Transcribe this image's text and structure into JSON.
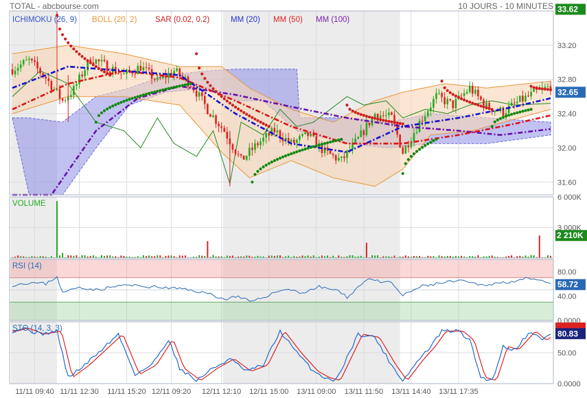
{
  "header": {
    "source": "TOTAL - abcbourse.com",
    "period": "10 JOURS - 10 MINUTES"
  },
  "legend": [
    {
      "text": "ICHIMOKU (26, 9)",
      "color": "#3355cc"
    },
    {
      "text": "BOLL (20, 2)",
      "color": "#e8963c"
    },
    {
      "text": "SAR (0.02, 0.2)",
      "color": "#cc2020"
    },
    {
      "text": "MM (20)",
      "color": "#2233cc"
    },
    {
      "text": "MM (50)",
      "color": "#dd2222"
    },
    {
      "text": "MM (100)",
      "color": "#7722aa"
    }
  ],
  "colors": {
    "bull": "#22aa22",
    "bear": "#dd2222",
    "sar": "#cc2020",
    "sar_bull": "#118811",
    "boll_fill": "#f6d6b4",
    "boll_line": "#e8963c",
    "kumo_fill": "#8f8fe8",
    "chikou": "#228822",
    "mm20": "#1111cc",
    "mm50": "#dd1111",
    "mm100": "#6611aa",
    "rsi_line": "#2a6ab5",
    "sto_k": "#2266cc",
    "sto_d": "#dd2222",
    "badge_green": "#1d8a1d",
    "badge_blue": "#2a6ab5",
    "badge_navy": "#1a237e"
  },
  "chart_data": [
    {
      "type": "candlestick",
      "name": "price",
      "yticks": [
        31.6,
        32.0,
        32.4,
        32.8,
        33.2
      ],
      "ytick_labels": [
        "31.60",
        "32.00",
        "32.40",
        "32.80",
        "33.20"
      ],
      "ylim": [
        31.45,
        33.6
      ],
      "badges": [
        {
          "text": "33.62",
          "value": 33.62,
          "color": "#1d8a1d"
        },
        {
          "text": "32.65",
          "value": 32.65,
          "color": "#2a6ab5"
        }
      ],
      "close_anchors": [
        [
          0,
          32.92
        ],
        [
          6,
          33.02
        ],
        [
          12,
          32.82
        ],
        [
          18,
          32.55
        ],
        [
          22,
          32.68
        ],
        [
          28,
          33.05
        ],
        [
          34,
          32.95
        ],
        [
          40,
          32.85
        ],
        [
          46,
          32.95
        ],
        [
          52,
          32.78
        ],
        [
          58,
          32.9
        ],
        [
          64,
          32.75
        ],
        [
          70,
          32.45
        ],
        [
          76,
          32.2
        ],
        [
          82,
          31.85
        ],
        [
          88,
          32.05
        ],
        [
          94,
          32.2
        ],
        [
          100,
          32.05
        ],
        [
          106,
          32.15
        ],
        [
          112,
          31.95
        ],
        [
          118,
          31.85
        ],
        [
          124,
          32.1
        ],
        [
          130,
          32.4
        ],
        [
          136,
          32.35
        ],
        [
          140,
          31.95
        ],
        [
          146,
          32.3
        ],
        [
          152,
          32.6
        ],
        [
          158,
          32.5
        ],
        [
          164,
          32.7
        ],
        [
          170,
          32.48
        ],
        [
          176,
          32.42
        ],
        [
          182,
          32.55
        ],
        [
          188,
          32.65
        ],
        [
          193,
          32.72
        ]
      ],
      "mm20_anchors": [
        [
          0,
          32.7
        ],
        [
          20,
          32.95
        ],
        [
          40,
          32.9
        ],
        [
          60,
          32.85
        ],
        [
          80,
          32.4
        ],
        [
          100,
          32.05
        ],
        [
          120,
          31.95
        ],
        [
          140,
          32.25
        ],
        [
          160,
          32.35
        ],
        [
          180,
          32.48
        ],
        [
          193,
          32.58
        ]
      ],
      "mm50_anchors": [
        [
          0,
          32.45
        ],
        [
          20,
          32.75
        ],
        [
          40,
          32.9
        ],
        [
          60,
          32.82
        ],
        [
          80,
          32.55
        ],
        [
          100,
          32.25
        ],
        [
          120,
          32.05
        ],
        [
          140,
          32.05
        ],
        [
          160,
          32.15
        ],
        [
          180,
          32.28
        ],
        [
          193,
          32.38
        ]
      ],
      "mm100_anchors": [
        [
          14,
          31.45
        ],
        [
          30,
          32.2
        ],
        [
          45,
          32.58
        ],
        [
          60,
          32.72
        ],
        [
          80,
          32.62
        ],
        [
          100,
          32.48
        ],
        [
          120,
          32.35
        ],
        [
          140,
          32.25
        ],
        [
          160,
          32.2
        ],
        [
          175,
          32.15
        ],
        [
          193,
          32.22
        ]
      ],
      "boll_upper": [
        [
          0,
          33.1
        ],
        [
          20,
          33.2
        ],
        [
          40,
          33.1
        ],
        [
          60,
          32.95
        ],
        [
          75,
          32.95
        ],
        [
          85,
          32.7
        ],
        [
          100,
          32.45
        ],
        [
          115,
          32.3
        ],
        [
          130,
          32.55
        ],
        [
          140,
          32.65
        ],
        [
          155,
          32.75
        ],
        [
          170,
          32.7
        ],
        [
          193,
          32.78
        ]
      ],
      "boll_lower": [
        [
          0,
          32.4
        ],
        [
          20,
          32.6
        ],
        [
          40,
          32.6
        ],
        [
          60,
          32.5
        ],
        [
          75,
          31.95
        ],
        [
          85,
          31.65
        ],
        [
          100,
          31.85
        ],
        [
          115,
          31.65
        ],
        [
          130,
          31.55
        ],
        [
          140,
          31.75
        ],
        [
          150,
          32.15
        ],
        [
          165,
          32.2
        ],
        [
          193,
          32.45
        ]
      ],
      "kumo_upper": [
        [
          0,
          32.35
        ],
        [
          6,
          32.35
        ],
        [
          18,
          32.3
        ],
        [
          30,
          32.6
        ],
        [
          42,
          32.7
        ],
        [
          55,
          32.85
        ],
        [
          70,
          32.9
        ],
        [
          80,
          32.92
        ],
        [
          90,
          32.92
        ],
        [
          102,
          32.92
        ],
        [
          102,
          32.35
        ],
        [
          120,
          32.35
        ],
        [
          135,
          32.3
        ],
        [
          150,
          32.4
        ],
        [
          170,
          32.35
        ],
        [
          193,
          32.3
        ]
      ],
      "kumo_lower": [
        [
          0,
          32.35
        ],
        [
          6,
          31.45
        ],
        [
          18,
          31.45
        ],
        [
          30,
          32.0
        ],
        [
          42,
          32.5
        ],
        [
          55,
          32.65
        ],
        [
          70,
          32.7
        ],
        [
          80,
          32.55
        ],
        [
          90,
          32.55
        ],
        [
          102,
          32.2
        ],
        [
          120,
          32.05
        ],
        [
          135,
          32.0
        ],
        [
          150,
          32.05
        ],
        [
          170,
          32.05
        ],
        [
          193,
          32.15
        ]
      ],
      "chikou_anchors": [
        [
          0,
          32.6
        ],
        [
          10,
          32.9
        ],
        [
          20,
          32.75
        ],
        [
          30,
          32.3
        ],
        [
          40,
          32.2
        ],
        [
          46,
          32.0
        ],
        [
          52,
          32.35
        ],
        [
          58,
          32.05
        ],
        [
          66,
          31.9
        ],
        [
          72,
          32.2
        ],
        [
          78,
          31.58
        ],
        [
          82,
          32.3
        ],
        [
          90,
          32.15
        ],
        [
          96,
          32.45
        ],
        [
          102,
          32.25
        ],
        [
          108,
          32.3
        ],
        [
          114,
          32.45
        ],
        [
          120,
          32.6
        ],
        [
          126,
          32.5
        ],
        [
          134,
          32.55
        ],
        [
          140,
          32.35
        ],
        [
          148,
          32.45
        ],
        [
          156,
          32.4
        ],
        [
          164,
          32.5
        ],
        [
          172,
          32.55
        ],
        [
          180,
          32.5
        ],
        [
          193,
          32.52
        ]
      ],
      "sar_segments": [
        {
          "bull": false,
          "from": 16,
          "to": 35,
          "start": 33.55,
          "end": 32.85
        },
        {
          "bull": true,
          "from": 30,
          "to": 64,
          "start": 32.3,
          "end": 32.75
        },
        {
          "bull": false,
          "from": 66,
          "to": 92,
          "start": 33.1,
          "end": 32.25
        },
        {
          "bull": true,
          "from": 86,
          "to": 118,
          "start": 31.6,
          "end": 32.1
        },
        {
          "bull": false,
          "from": 120,
          "to": 140,
          "start": 32.5,
          "end": 32.28
        },
        {
          "bull": true,
          "from": 140,
          "to": 152,
          "start": 31.7,
          "end": 32.1
        },
        {
          "bull": false,
          "from": 154,
          "to": 172,
          "start": 32.78,
          "end": 32.45
        },
        {
          "bull": true,
          "from": 172,
          "to": 186,
          "start": 32.25,
          "end": 32.45
        },
        {
          "bull": false,
          "from": 186,
          "to": 193,
          "start": 32.72,
          "end": 32.68
        }
      ]
    },
    {
      "type": "bar",
      "name": "volume",
      "title": "VOLUME",
      "ylim": [
        0,
        6000
      ],
      "yticks": [
        6000,
        3000
      ],
      "ytick_labels": [
        "6 000K",
        "3 000K"
      ],
      "badge": {
        "text": "2 210K",
        "value": 2210,
        "color": "#1d8a1d"
      },
      "spikes": [
        [
          16,
          5600,
          true
        ],
        [
          18,
          500,
          true
        ],
        [
          40,
          200,
          false
        ],
        [
          70,
          1650,
          false
        ],
        [
          72,
          300,
          true
        ],
        [
          127,
          1500,
          false
        ],
        [
          130,
          250,
          true
        ],
        [
          186,
          300,
          true
        ],
        [
          189,
          2210,
          false
        ]
      ]
    },
    {
      "type": "line",
      "name": "rsi",
      "title": "RSI (14)",
      "ylim": [
        0,
        100
      ],
      "yticks": [
        80,
        40,
        0
      ],
      "ytick_labels": [
        "80.00",
        "40.00",
        "0.0000"
      ],
      "overbought": 70,
      "oversold": 30,
      "badge": {
        "text": "58.72",
        "value": 58.72,
        "color": "#2a6ab5"
      },
      "anchors": [
        [
          0,
          58
        ],
        [
          6,
          62
        ],
        [
          12,
          60
        ],
        [
          16,
          72
        ],
        [
          18,
          45
        ],
        [
          24,
          55
        ],
        [
          30,
          50
        ],
        [
          40,
          58
        ],
        [
          50,
          55
        ],
        [
          60,
          52
        ],
        [
          66,
          48
        ],
        [
          72,
          42
        ],
        [
          76,
          34
        ],
        [
          80,
          40
        ],
        [
          86,
          30
        ],
        [
          92,
          42
        ],
        [
          98,
          52
        ],
        [
          104,
          45
        ],
        [
          110,
          55
        ],
        [
          116,
          50
        ],
        [
          120,
          38
        ],
        [
          124,
          55
        ],
        [
          128,
          70
        ],
        [
          132,
          62
        ],
        [
          136,
          62
        ],
        [
          140,
          40
        ],
        [
          146,
          55
        ],
        [
          152,
          60
        ],
        [
          160,
          65
        ],
        [
          168,
          58
        ],
        [
          176,
          62
        ],
        [
          184,
          68
        ],
        [
          190,
          64
        ],
        [
          193,
          58.72
        ]
      ]
    },
    {
      "type": "line",
      "name": "stochastic",
      "title": "STO (14, 3, 3)",
      "ylim": [
        0,
        100
      ],
      "yticks": [
        50,
        0
      ],
      "ytick_labels": [
        "50.00",
        "0.0000"
      ],
      "badge_k": {
        "text": "80.83",
        "value": 80.83,
        "color": "#1a237e"
      },
      "badge_d": {
        "value": 90,
        "color": "#dd2222"
      },
      "k_anchors": [
        [
          0,
          85
        ],
        [
          4,
          90
        ],
        [
          10,
          80
        ],
        [
          16,
          85
        ],
        [
          20,
          10
        ],
        [
          26,
          30
        ],
        [
          32,
          55
        ],
        [
          38,
          80
        ],
        [
          44,
          15
        ],
        [
          50,
          30
        ],
        [
          56,
          72
        ],
        [
          60,
          25
        ],
        [
          66,
          5
        ],
        [
          72,
          25
        ],
        [
          78,
          40
        ],
        [
          84,
          20
        ],
        [
          90,
          30
        ],
        [
          96,
          85
        ],
        [
          102,
          50
        ],
        [
          108,
          20
        ],
        [
          112,
          10
        ],
        [
          116,
          5
        ],
        [
          124,
          80
        ],
        [
          130,
          75
        ],
        [
          136,
          30
        ],
        [
          140,
          5
        ],
        [
          146,
          40
        ],
        [
          150,
          60
        ],
        [
          154,
          85
        ],
        [
          160,
          85
        ],
        [
          164,
          70
        ],
        [
          168,
          10
        ],
        [
          172,
          5
        ],
        [
          176,
          60
        ],
        [
          180,
          55
        ],
        [
          186,
          85
        ],
        [
          190,
          70
        ],
        [
          193,
          80.83
        ]
      ],
      "d_lag": 1.6
    }
  ],
  "xaxis": {
    "n_bars": 194,
    "labels": [
      {
        "text": "11/11 09:40",
        "bar": 8
      },
      {
        "text": "11/11 12:30",
        "bar": 24
      },
      {
        "text": "11/11 15:20",
        "bar": 41
      },
      {
        "text": "12/11 09:20",
        "bar": 57
      },
      {
        "text": "12/11 12:10",
        "bar": 75
      },
      {
        "text": "12/11 15:00",
        "bar": 92
      },
      {
        "text": "13/11 09:00",
        "bar": 109
      },
      {
        "text": "13/11 11:50",
        "bar": 126
      },
      {
        "text": "13/11 14:40",
        "bar": 143
      },
      {
        "text": "13/11 17:35",
        "bar": 160
      }
    ],
    "shaded_sessions": [
      [
        0,
        16
      ],
      [
        76,
        139
      ]
    ]
  }
}
